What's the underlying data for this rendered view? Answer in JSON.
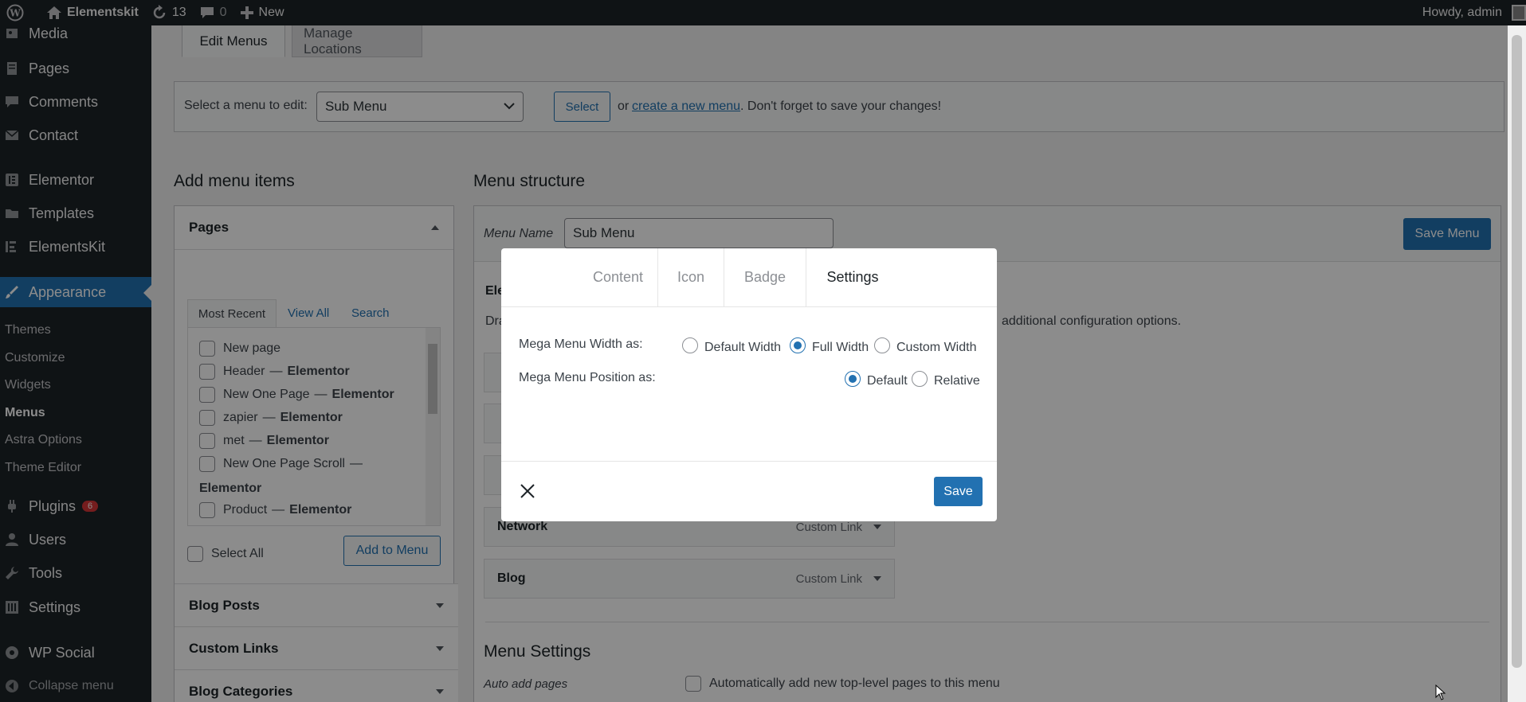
{
  "admin_bar": {
    "site_name": "Elementskit",
    "updates_count": "13",
    "comments_count": "0",
    "new_label": "New",
    "howdy": "Howdy, admin"
  },
  "sidebar": {
    "items": [
      {
        "label": "Media",
        "icon": "media-icon"
      },
      {
        "label": "Pages",
        "icon": "pages-icon"
      },
      {
        "label": "Comments",
        "icon": "comments-icon"
      },
      {
        "label": "Contact",
        "icon": "envelope-icon"
      },
      {
        "label": "Elementor",
        "icon": "elementor-icon"
      },
      {
        "label": "Templates",
        "icon": "folder-icon"
      },
      {
        "label": "ElementsKit",
        "icon": "elementskit-icon"
      },
      {
        "label": "Appearance",
        "icon": "brush-icon"
      }
    ],
    "submenu": [
      "Themes",
      "Customize",
      "Widgets",
      "Menus",
      "Astra Options",
      "Theme Editor"
    ],
    "items_bottom": [
      {
        "label": "Plugins",
        "icon": "plugin-icon",
        "badge": "6"
      },
      {
        "label": "Users",
        "icon": "users-icon"
      },
      {
        "label": "Tools",
        "icon": "wrench-icon"
      },
      {
        "label": "Settings",
        "icon": "settings-icon"
      },
      {
        "label": "WP Social",
        "icon": "share-icon"
      },
      {
        "label": "Collapse menu",
        "icon": "collapse-icon"
      }
    ]
  },
  "tabs": {
    "edit": "Edit Menus",
    "manage": "Manage Locations"
  },
  "select_bar": {
    "label": "Select a menu to edit:",
    "selected": "Sub Menu",
    "button": "Select",
    "or_text": "or",
    "create_link": "create a new menu",
    "tail": ". Don't forget to save your changes!"
  },
  "add_items": {
    "heading": "Add menu items",
    "pages_title": "Pages",
    "subtabs": [
      "Most Recent",
      "View All",
      "Search"
    ],
    "pages": [
      {
        "name": "New page",
        "suffix": ""
      },
      {
        "name": "Header",
        "suffix": "Elementor"
      },
      {
        "name": "New One Page",
        "suffix": "Elementor"
      },
      {
        "name": "zapier",
        "suffix": "Elementor"
      },
      {
        "name": "met",
        "suffix": "Elementor"
      },
      {
        "name": "New One Page Scroll",
        "suffix": "Elementor"
      },
      {
        "name": "Product",
        "suffix": "Elementor"
      }
    ],
    "select_all": "Select All",
    "add_button": "Add to Menu",
    "sections": [
      "Blog Posts",
      "Custom Links",
      "Blog Categories"
    ]
  },
  "structure": {
    "heading": "Menu structure",
    "name_label": "Menu Name",
    "name_value": "Sub Menu",
    "save_button": "Save Menu",
    "ele_text": "Ele",
    "dra_text": "Dra",
    "config_text": "additional configuration options.",
    "cards": [
      {
        "title": "Network",
        "type": "Custom Link"
      },
      {
        "title": "Blog",
        "type": "Custom Link"
      }
    ],
    "settings_heading": "Menu Settings",
    "auto_add_label": "Auto add pages",
    "auto_add_text": "Automatically add new top-level pages to this menu"
  },
  "modal": {
    "tabs": [
      "Content",
      "Icon",
      "Badge",
      "Settings"
    ],
    "active_tab": "Settings",
    "width_label": "Mega Menu Width as:",
    "width_options": [
      "Default Width",
      "Full Width",
      "Custom Width"
    ],
    "width_selected": "Full Width",
    "position_label": "Mega Menu Position as:",
    "position_options": [
      "Default",
      "Relative"
    ],
    "position_selected": "Default",
    "save_button": "Save"
  },
  "colors": {
    "accent": "#2271b1",
    "adminbar": "#1d2327",
    "badge": "#d63638"
  }
}
